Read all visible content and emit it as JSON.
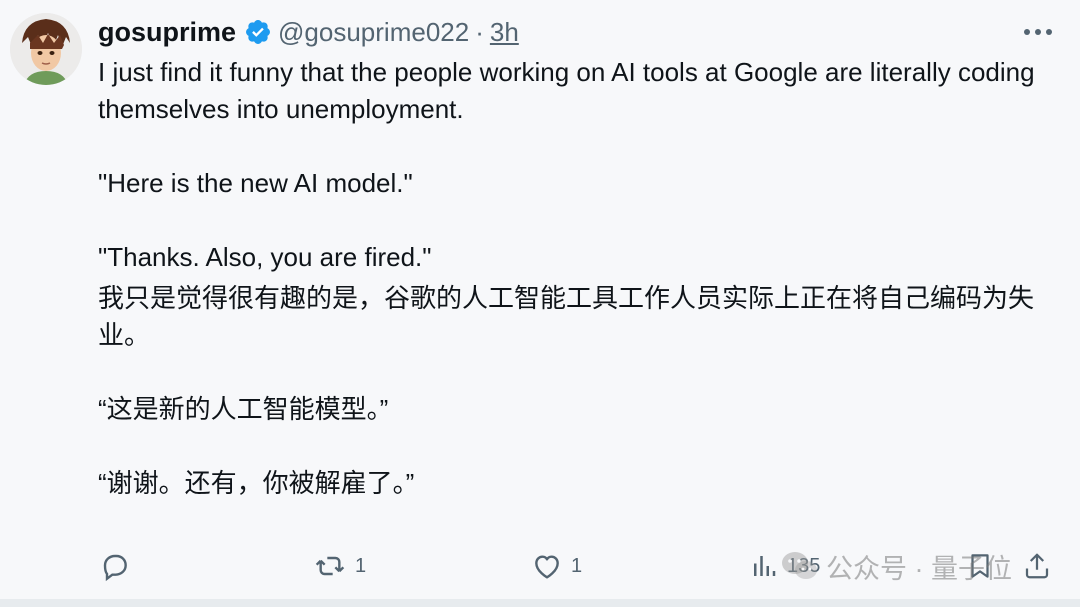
{
  "post": {
    "author_name": "gosuprime",
    "handle": "@gosuprime022",
    "separator": "·",
    "time": "3h",
    "text_en": [
      "I just find it funny that the people working on AI tools at Google are literally coding themselves into unemployment.",
      "\"Here is the new AI model.\"",
      "\"Thanks.  Also, you are fired.\""
    ],
    "text_cn": [
      "我只是觉得很有趣的是，谷歌的人工智能工具工作人员实际上正在将自己编码为失业。",
      "“这是新的人工智能模型。”",
      "“谢谢。还有，你被解雇了。”"
    ]
  },
  "actions": {
    "reply_count": "",
    "repost_count": "1",
    "like_count": "1",
    "views_count": "135"
  },
  "watermark": {
    "text": "公众号 · 量子位"
  },
  "icons": {
    "verified": "verified-badge-icon",
    "more": "more-icon",
    "reply": "reply-icon",
    "repost": "repost-icon",
    "like": "heart-icon",
    "views": "views-icon",
    "bookmark": "bookmark-icon",
    "share": "share-icon",
    "watermark": "wechat-icon"
  },
  "colors": {
    "background": "#f7f8fa",
    "text": "#0f1419",
    "muted": "#536471",
    "verified": "#1d9bf0"
  }
}
